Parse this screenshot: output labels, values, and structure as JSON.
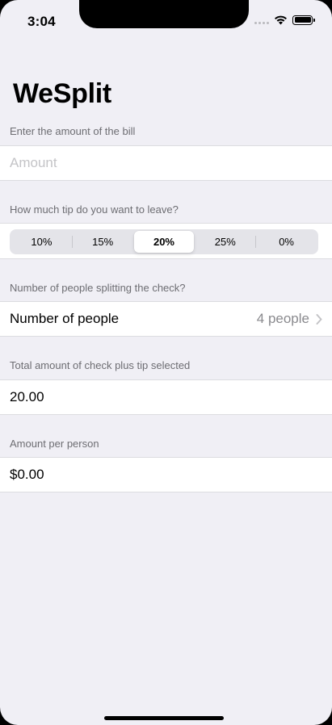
{
  "status_bar": {
    "time": "3:04"
  },
  "nav": {
    "title": "WeSplit"
  },
  "bill_section": {
    "header": "Enter the amount of the bill",
    "amount_placeholder": "Amount"
  },
  "tip_section": {
    "header": "How much tip do you want to leave?",
    "options": [
      "10%",
      "15%",
      "20%",
      "25%",
      "0%"
    ],
    "selected": "20%"
  },
  "people_section": {
    "header": "Number of people splitting the check?",
    "label": "Number of people",
    "value": "4 people"
  },
  "total_section": {
    "header": "Total amount of check plus tip selected",
    "value": "20.00"
  },
  "per_person_section": {
    "header": "Amount per person",
    "value": "$0.00"
  },
  "colors": {
    "background": "#f0eff5",
    "cell": "#ffffff",
    "secondary_text": "#6d6d72"
  }
}
